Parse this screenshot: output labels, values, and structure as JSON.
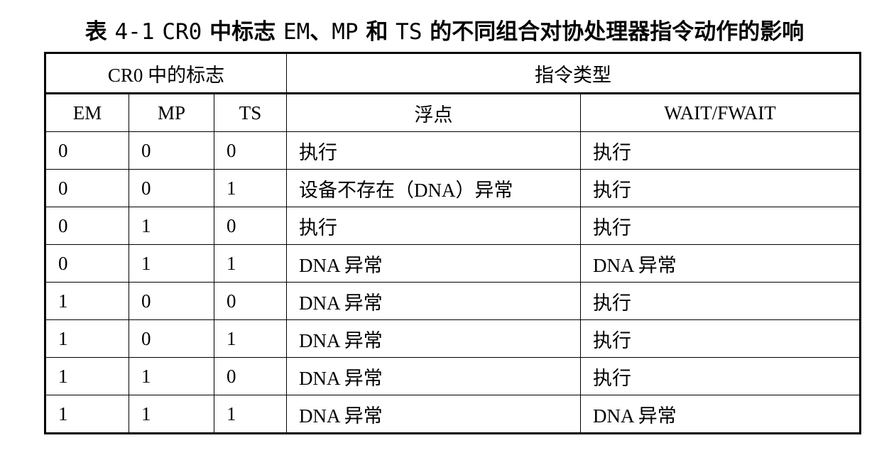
{
  "caption": {
    "prefix": "表",
    "number": "4-1",
    "reg": "CR0",
    "t1": "中标志",
    "f1": "EM",
    "sep": "、",
    "f2": "MP",
    "t2": "和",
    "f3": "TS",
    "t3": "的不同组合对协处理器指令动作的影响"
  },
  "table": {
    "group_headers": [
      "CR0 中的标志",
      "指令类型"
    ],
    "columns": [
      "EM",
      "MP",
      "TS",
      "浮点",
      "WAIT/FWAIT"
    ],
    "rows": [
      [
        "0",
        "0",
        "0",
        "执行",
        "执行"
      ],
      [
        "0",
        "0",
        "1",
        "设备不存在（DNA）异常",
        "执行"
      ],
      [
        "0",
        "1",
        "0",
        "执行",
        "执行"
      ],
      [
        "0",
        "1",
        "1",
        "DNA 异常",
        "DNA 异常"
      ],
      [
        "1",
        "0",
        "0",
        "DNA 异常",
        "执行"
      ],
      [
        "1",
        "0",
        "1",
        "DNA 异常",
        "执行"
      ],
      [
        "1",
        "1",
        "0",
        "DNA 异常",
        "执行"
      ],
      [
        "1",
        "1",
        "1",
        "DNA 异常",
        "DNA 异常"
      ]
    ]
  }
}
